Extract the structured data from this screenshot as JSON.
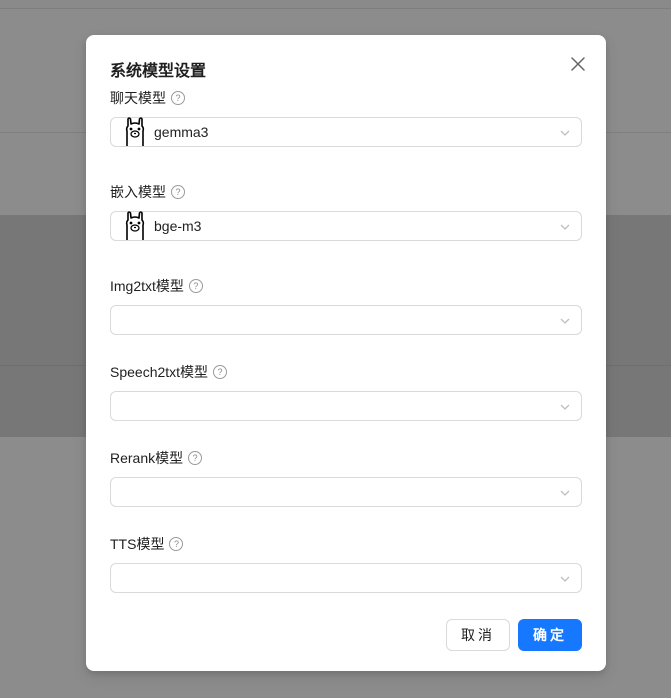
{
  "dialog": {
    "title": "系统模型设置",
    "fields": [
      {
        "label": "聊天模型",
        "value": "gemma3",
        "icon": "ollama-llama-icon"
      },
      {
        "label": "嵌入模型",
        "value": "bge-m3",
        "icon": "ollama-llama-icon"
      },
      {
        "label": "Img2txt模型",
        "value": ""
      },
      {
        "label": "Speech2txt模型",
        "value": ""
      },
      {
        "label": "Rerank模型",
        "value": ""
      },
      {
        "label": "TTS模型",
        "value": ""
      }
    ],
    "help_glyph": "?",
    "cancel_label": "取消",
    "ok_label": "确定"
  },
  "colors": {
    "primary": "#1677ff",
    "overlay": "#8c8c8c"
  }
}
